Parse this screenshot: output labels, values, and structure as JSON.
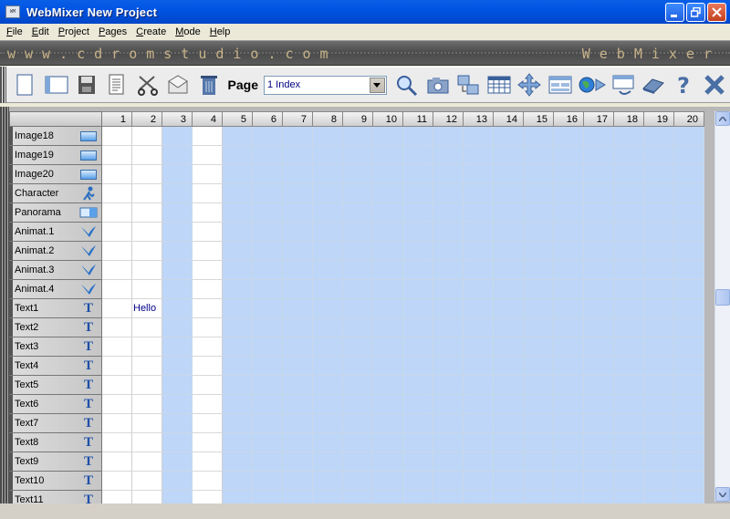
{
  "window": {
    "title": "WebMixer  New Project",
    "app_icon_text": "WM"
  },
  "menu": [
    {
      "label": "File",
      "u": "F",
      "rest": "ile"
    },
    {
      "label": "Edit",
      "u": "E",
      "rest": "dit"
    },
    {
      "label": "Project",
      "u": "P",
      "rest": "roject"
    },
    {
      "label": "Pages",
      "u": "P",
      "rest": "ages"
    },
    {
      "label": "Create",
      "u": "C",
      "rest": "reate"
    },
    {
      "label": "Mode",
      "u": "M",
      "rest": "ode"
    },
    {
      "label": "Help",
      "u": "H",
      "rest": "elp"
    }
  ],
  "banner": {
    "left": "www.cdromstudio.com",
    "right": "WebMixer"
  },
  "toolbar": {
    "page_label": "Page",
    "page_select_value": "1  Index",
    "icons": [
      "new-page-icon",
      "new-window-icon",
      "save-icon",
      "document-icon",
      "scissors-icon",
      "mail-icon",
      "trash-icon",
      "zoom-icon",
      "camera-icon",
      "transfer-icon",
      "table-icon",
      "move-icon",
      "layout-icon",
      "globe-icon",
      "monitor-icon",
      "eraser-icon",
      "help-icon",
      "exit-icon"
    ]
  },
  "grid": {
    "columns": [
      "1",
      "2",
      "3",
      "4",
      "5",
      "6",
      "7",
      "8",
      "9",
      "10",
      "11",
      "12",
      "13",
      "14",
      "15",
      "16",
      "17",
      "18",
      "19",
      "20"
    ],
    "white_columns": [
      0,
      1,
      3
    ],
    "rows": [
      {
        "label": "Image18",
        "icon": "image-icon"
      },
      {
        "label": "Image19",
        "icon": "image-icon"
      },
      {
        "label": "Image20",
        "icon": "image-icon"
      },
      {
        "label": "Character",
        "icon": "character-icon"
      },
      {
        "label": "Panorama",
        "icon": "panorama-icon"
      },
      {
        "label": "Animat.1",
        "icon": "bird-icon"
      },
      {
        "label": "Animat.2",
        "icon": "bird-icon"
      },
      {
        "label": "Animat.3",
        "icon": "bird-icon"
      },
      {
        "label": "Animat.4",
        "icon": "bird-icon"
      },
      {
        "label": "Text1",
        "icon": "text-icon"
      },
      {
        "label": "Text2",
        "icon": "text-icon"
      },
      {
        "label": "Text3",
        "icon": "text-icon"
      },
      {
        "label": "Text4",
        "icon": "text-icon"
      },
      {
        "label": "Text5",
        "icon": "text-icon"
      },
      {
        "label": "Text6",
        "icon": "text-icon"
      },
      {
        "label": "Text7",
        "icon": "text-icon"
      },
      {
        "label": "Text8",
        "icon": "text-icon"
      },
      {
        "label": "Text9",
        "icon": "text-icon"
      },
      {
        "label": "Text10",
        "icon": "text-icon"
      },
      {
        "label": "Text11",
        "icon": "text-icon"
      }
    ],
    "cell_values": [
      {
        "row": 9,
        "col": 1,
        "text": "Hello"
      }
    ]
  },
  "colors": {
    "grid_blue": "#bed6f7",
    "title_blue": "#0054e3",
    "text_blue": "#00008b"
  }
}
